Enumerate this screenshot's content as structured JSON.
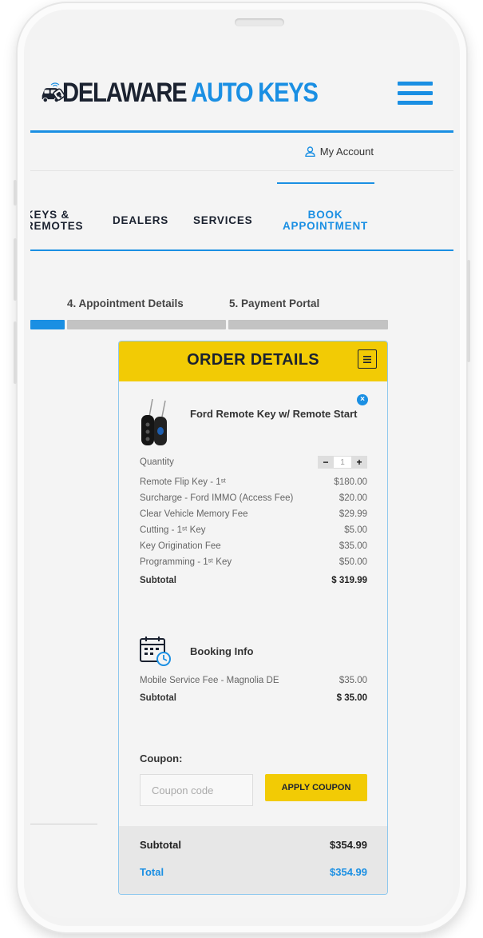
{
  "brand": {
    "name_dark": "DELAWARE",
    "name_blue": "AUTO KEYS",
    "accent": "#1a8fe3",
    "yellow": "#f2cb05"
  },
  "header": {
    "menu_icon": "hamburger-menu-icon"
  },
  "account": {
    "label": "My Account",
    "icon": "user-icon"
  },
  "nav": {
    "items": [
      "KEYS &\nREMOTES",
      "DEALERS",
      "SERVICES",
      "BOOK\nAPPOINTMENT"
    ],
    "keys_line1": "KEYS &",
    "keys_line2": "REMOTES",
    "dealers": "DEALERS",
    "services": "SERVICES",
    "book_line1": "BOOK",
    "book_line2": "APPOINTMENT"
  },
  "steps": {
    "step4": "4. Appointment Details",
    "step5": "5. Payment Portal"
  },
  "order": {
    "title": "ORDER DETAILS",
    "product": {
      "name": "Ford Remote Key w/ Remote Start",
      "quantity_label": "Quantity",
      "quantity": "1",
      "lines": [
        {
          "label": "Remote Flip Key - 1ˢᵗ",
          "amount": "$180.00"
        },
        {
          "label": "Surcharge - Ford IMMO (Access Fee)",
          "amount": "$20.00"
        },
        {
          "label": "Clear Vehicle Memory Fee",
          "amount": "$29.99"
        },
        {
          "label": "Cutting - 1ˢᵗ Key",
          "amount": "$5.00"
        },
        {
          "label": "Key Origination Fee",
          "amount": "$35.00"
        },
        {
          "label": "Programming - 1ˢᵗ Key",
          "amount": "$50.00"
        }
      ],
      "subtotal_label": "Subtotal",
      "subtotal": "$ 319.99"
    },
    "booking": {
      "title": "Booking Info",
      "lines": [
        {
          "label": "Mobile Service Fee - Magnolia DE",
          "amount": "$35.00"
        }
      ],
      "subtotal_label": "Subtotal",
      "subtotal": "$ 35.00"
    },
    "coupon": {
      "label": "Coupon:",
      "placeholder": "Coupon code",
      "button": "APPLY COUPON"
    },
    "totals": {
      "subtotal_label": "Subtotal",
      "subtotal": "$354.99",
      "total_label": "Total",
      "total": "$354.99"
    }
  }
}
